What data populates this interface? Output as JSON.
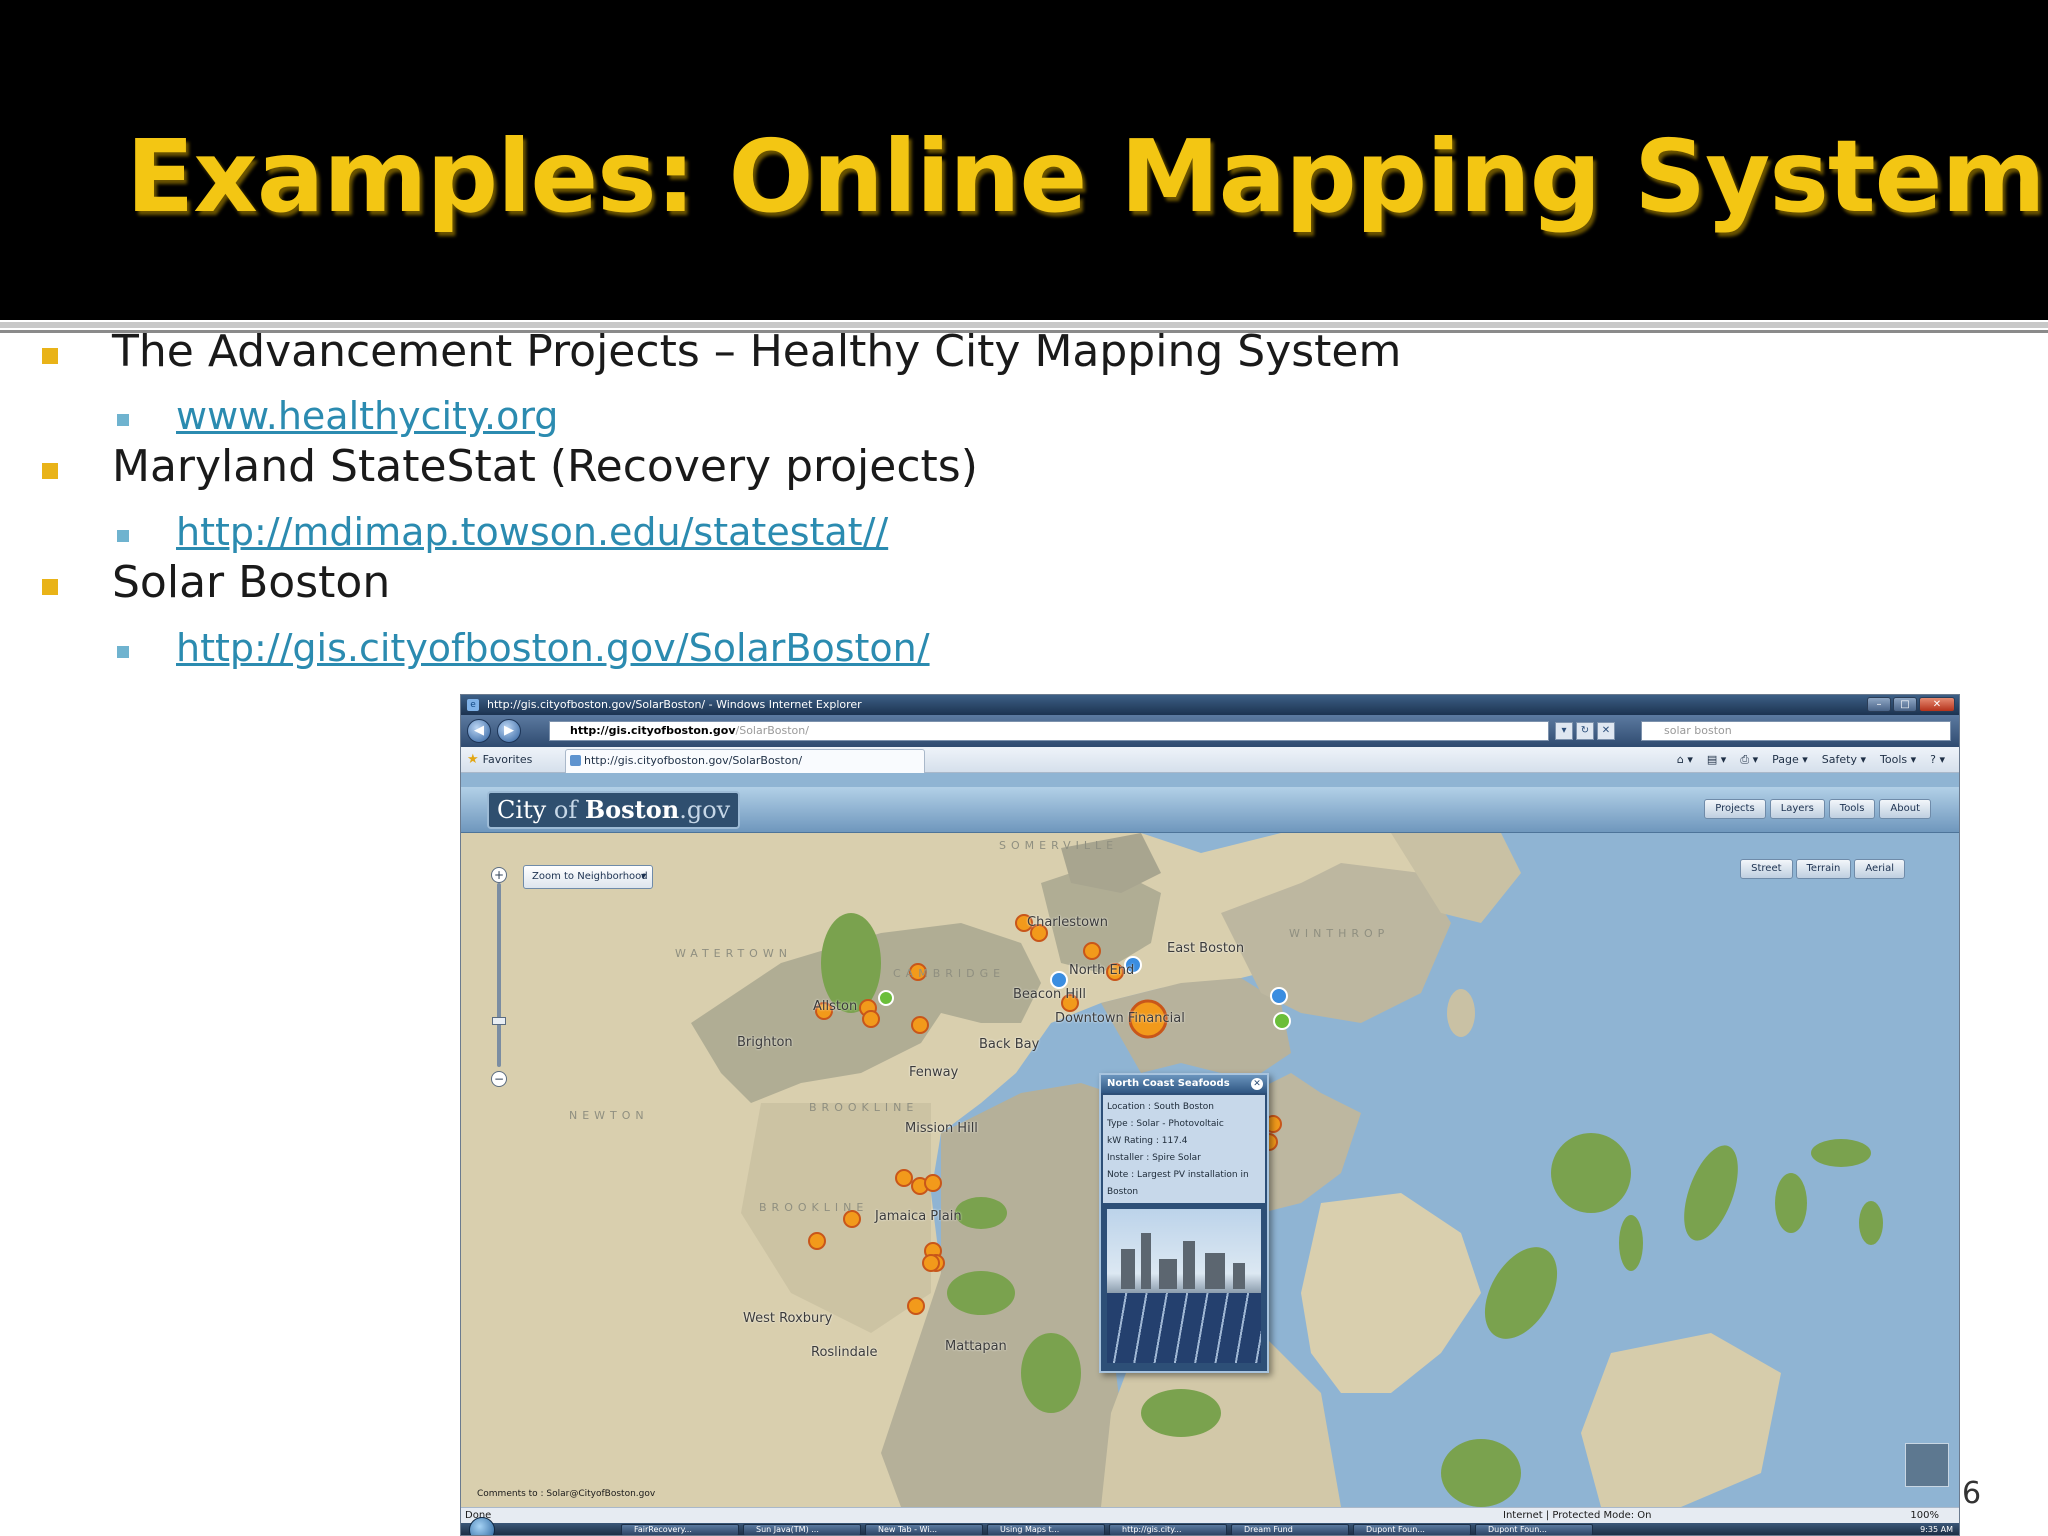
{
  "slide": {
    "title": "Examples: Online Mapping Systems",
    "page_number": "6",
    "bullets": [
      {
        "text": "The Advancement Projects – Healthy City Mapping System",
        "link": "www.healthycity.org"
      },
      {
        "text": "Maryland StateStat (Recovery projects)",
        "link": "http://mdimap.towson.edu/statestat//"
      },
      {
        "text": "Solar Boston",
        "link": "http://gis.cityofboston.gov/SolarBoston/"
      }
    ],
    "bullet_color": "#e9b318",
    "link_color": "#2b8bb0",
    "title_color": "#f3c613"
  },
  "browser": {
    "window_title": "http://gis.cityofboston.gov/SolarBoston/ - Windows Internet Explorer",
    "address_host": "http://gis.cityofboston.gov",
    "address_path": "/SolarBoston/",
    "search_placeholder": "solar boston",
    "favorites_label": "Favorites",
    "tab_label": "http://gis.cityofboston.gov/SolarBoston/",
    "commands": [
      "Page ▾",
      "Safety ▾",
      "Tools ▾"
    ],
    "status_done": "Done",
    "status_zone": "Internet | Protected Mode: On",
    "status_zoom": "100%",
    "taskbar_items": [
      "FairRecovery...",
      "Sun Java(TM) ...",
      "New Tab - Wi...",
      "Using Maps t...",
      "http://gis.city...",
      "Dream Fund",
      "Dupont Foun...",
      "Dupont Foun..."
    ],
    "clock": "9:35 AM"
  },
  "app": {
    "brand_prefix": "City",
    "brand_of": "of",
    "brand_name": "Boston",
    "brand_suffix": ".gov",
    "top_tabs": [
      "Projects",
      "Layers",
      "Tools",
      "About"
    ],
    "layer_tabs": [
      "Street",
      "Terrain",
      "Aerial"
    ],
    "neighborhood_select": "Zoom to Neighborhood",
    "comments": "Comments to : Solar@CityofBoston.gov",
    "map_labels": [
      "Charlestown",
      "East Boston",
      "North End",
      "Beacon Hill",
      "Downtown Financial",
      "Allston",
      "Brighton",
      "Back Bay",
      "Fenway",
      "Mission Hill",
      "Jamaica Plain",
      "West Roxbury",
      "Roslindale",
      "Mattapan"
    ],
    "district_labels": [
      "SOMERVILLE",
      "WATERTOWN",
      "CAMBRIDGE",
      "NEWTON",
      "BROOKLINE",
      "BROOKLINE",
      "WINTHROP"
    ],
    "popup": {
      "title": "North Coast Seafoods",
      "location": "Location : South Boston",
      "type": "Type : Solar - Photovoltaic",
      "rating": "kW Rating : 117.4",
      "installer": "Installer : Spire Solar",
      "note": "Note : Largest PV installation in Boston"
    }
  }
}
